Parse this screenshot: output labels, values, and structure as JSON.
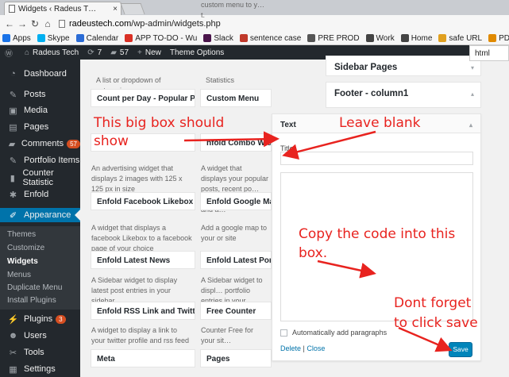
{
  "browser": {
    "tab_title": "Widgets ‹ Radeus T…",
    "tab_close": "×",
    "url_host": "radeustech.com",
    "url_path": "/wp-admin/widgets.php",
    "bookmarks": [
      {
        "label": "Apps",
        "icon": "apps-grid-icon",
        "color": "#1a73e8"
      },
      {
        "label": "Skype",
        "icon": "skype-icon",
        "color": "#00aff0"
      },
      {
        "label": "Calendar",
        "icon": "calendar-icon",
        "color": "#2b6cd6"
      },
      {
        "label": "APP TO-DO - Wu",
        "icon": "todo-icon",
        "color": "#d93025"
      },
      {
        "label": "Slack",
        "icon": "slack-icon",
        "color": "#4a154b"
      },
      {
        "label": "sentence case",
        "icon": "sentence-case-icon",
        "color": "#c0392b"
      },
      {
        "label": "PRE PROD",
        "icon": "refresh-icon",
        "color": "#555555"
      },
      {
        "label": "Work",
        "icon": "folder-icon",
        "color": "#444444"
      },
      {
        "label": "Home",
        "icon": "folder-icon",
        "color": "#444444"
      },
      {
        "label": "safe URL",
        "icon": "safe-url-icon",
        "color": "#e0a020"
      },
      {
        "label": "PDF Converter",
        "icon": "pdf-icon",
        "color": "#e08a00"
      }
    ],
    "dropdown_text": "html"
  },
  "adminbar": {
    "site_name": "Radeus Tech",
    "updates_count": "7",
    "comments_count": "57",
    "new_label": "New",
    "theme_options": "Theme Options"
  },
  "sidebar": {
    "items": [
      {
        "label": "Dashboard",
        "icon": "dashboard-icon"
      },
      {
        "label": "Posts",
        "icon": "pin-icon"
      },
      {
        "label": "Media",
        "icon": "media-icon"
      },
      {
        "label": "Pages",
        "icon": "page-icon"
      },
      {
        "label": "Comments",
        "icon": "comment-icon",
        "badge": "57"
      },
      {
        "label": "Portfolio Items",
        "icon": "pin-icon"
      },
      {
        "label": "Counter Statistic",
        "icon": "bar-chart-icon"
      },
      {
        "label": "Enfold",
        "icon": "gear-icon"
      },
      {
        "label": "Appearance",
        "icon": "brush-icon"
      },
      {
        "label": "Plugins",
        "icon": "plugin-icon",
        "badge": "3"
      },
      {
        "label": "Users",
        "icon": "users-icon"
      },
      {
        "label": "Tools",
        "icon": "wrench-icon"
      },
      {
        "label": "Settings",
        "icon": "settings-icon"
      }
    ],
    "submenu": [
      "Themes",
      "Customize",
      "Widgets",
      "Menus",
      "Duplicate Menu",
      "Install Plugins"
    ]
  },
  "widgets": {
    "top_desc_left": "A list or dropdown of categories.",
    "top_desc_right": "Statistics",
    "left": [
      {
        "title": "Count per Day - Popular Pos…",
        "desc": ""
      },
      {
        "title": "",
        "desc": "An advertising widget that displays 2 images with 125 x 125 px in size"
      },
      {
        "title": "Enfold Facebook Likebox",
        "desc": "A widget that displays a facebook Likebox to a facebook page of your choice"
      },
      {
        "title": "Enfold Latest News",
        "desc": "A Sidebar widget to display latest post entries in your sidebar"
      },
      {
        "title": "Enfold RSS Link and Twitter…",
        "desc": "A widget to display a link to your twitter profile and rss feed"
      },
      {
        "title": "Meta",
        "desc": ""
      }
    ],
    "right": [
      {
        "title": "Custom Menu",
        "desc": "custom menu to y… t."
      },
      {
        "title": "nfold Combo Widget",
        "desc": "A widget that displays your popular posts, recent po… recent comments and a…"
      },
      {
        "title": "Enfold Google Maps W",
        "desc": "Add a google map to your or site"
      },
      {
        "title": "Enfold Latest Portfoli",
        "desc": "A Sidebar widget to displ… portfolio entries in your…"
      },
      {
        "title": "Free Counter",
        "desc": "Counter Free for your sit…"
      },
      {
        "title": "Pages",
        "desc": ""
      }
    ]
  },
  "sidebars": {
    "sidebar_pages": "Sidebar Pages",
    "footer_col1": "Footer - column1"
  },
  "text_widget": {
    "header": "Text",
    "title_label": "Title:",
    "title_value": "",
    "content_value": "",
    "auto_paragraphs": "Automatically add paragraphs",
    "delete": "Delete",
    "separator": "|",
    "close": "Close",
    "save": "Save"
  },
  "annotations": {
    "big_box_line1": "This big box should",
    "big_box_line2": "show",
    "leave_blank": "Leave blank",
    "copy_line1": "Copy the code into this",
    "copy_line2": "box.",
    "save_line1": "Dont forget",
    "save_line2": "to click save"
  },
  "colors": {
    "admin_dark": "#23282d",
    "wp_blue": "#0073aa",
    "button_blue": "#0085ba",
    "annotation_red": "#e8231f",
    "badge_orange": "#d54e21"
  }
}
